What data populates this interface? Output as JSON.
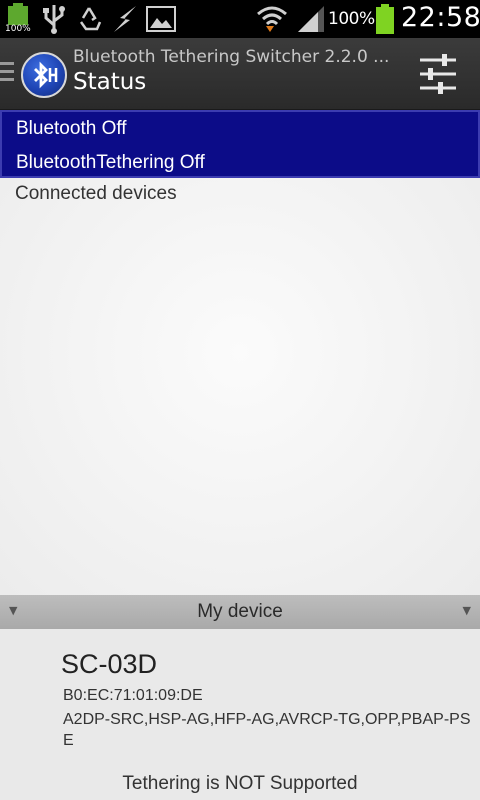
{
  "status_bar": {
    "battery_small_label": "100%",
    "battery_percent": "100%",
    "time": "22:58",
    "icons": [
      "battery-full-icon",
      "usb-icon",
      "recycle-icon",
      "bolt-icon",
      "image-icon",
      "wifi-icon",
      "signal-icon",
      "battery-icon"
    ]
  },
  "action_bar": {
    "subtitle": "Bluetooth Tethering Switcher 2.2.0 ...",
    "title": "Status",
    "logo_icon": "bluetooth-icon",
    "settings_icon": "sliders-icon"
  },
  "status": {
    "bluetooth": "Bluetooth Off",
    "tethering": "BluetoothTethering Off",
    "highlight_color": "#0c0c88"
  },
  "connected_devices": {
    "label": "Connected devices"
  },
  "my_device": {
    "header": "My device",
    "name": "SC-03D",
    "mac": "B0:EC:71:01:09:DE",
    "profiles": "A2DP-SRC,HSP-AG,HFP-AG,AVRCP-TG,OPP,PBAP-PSE",
    "tethering_status": "Tethering is NOT Supported"
  }
}
